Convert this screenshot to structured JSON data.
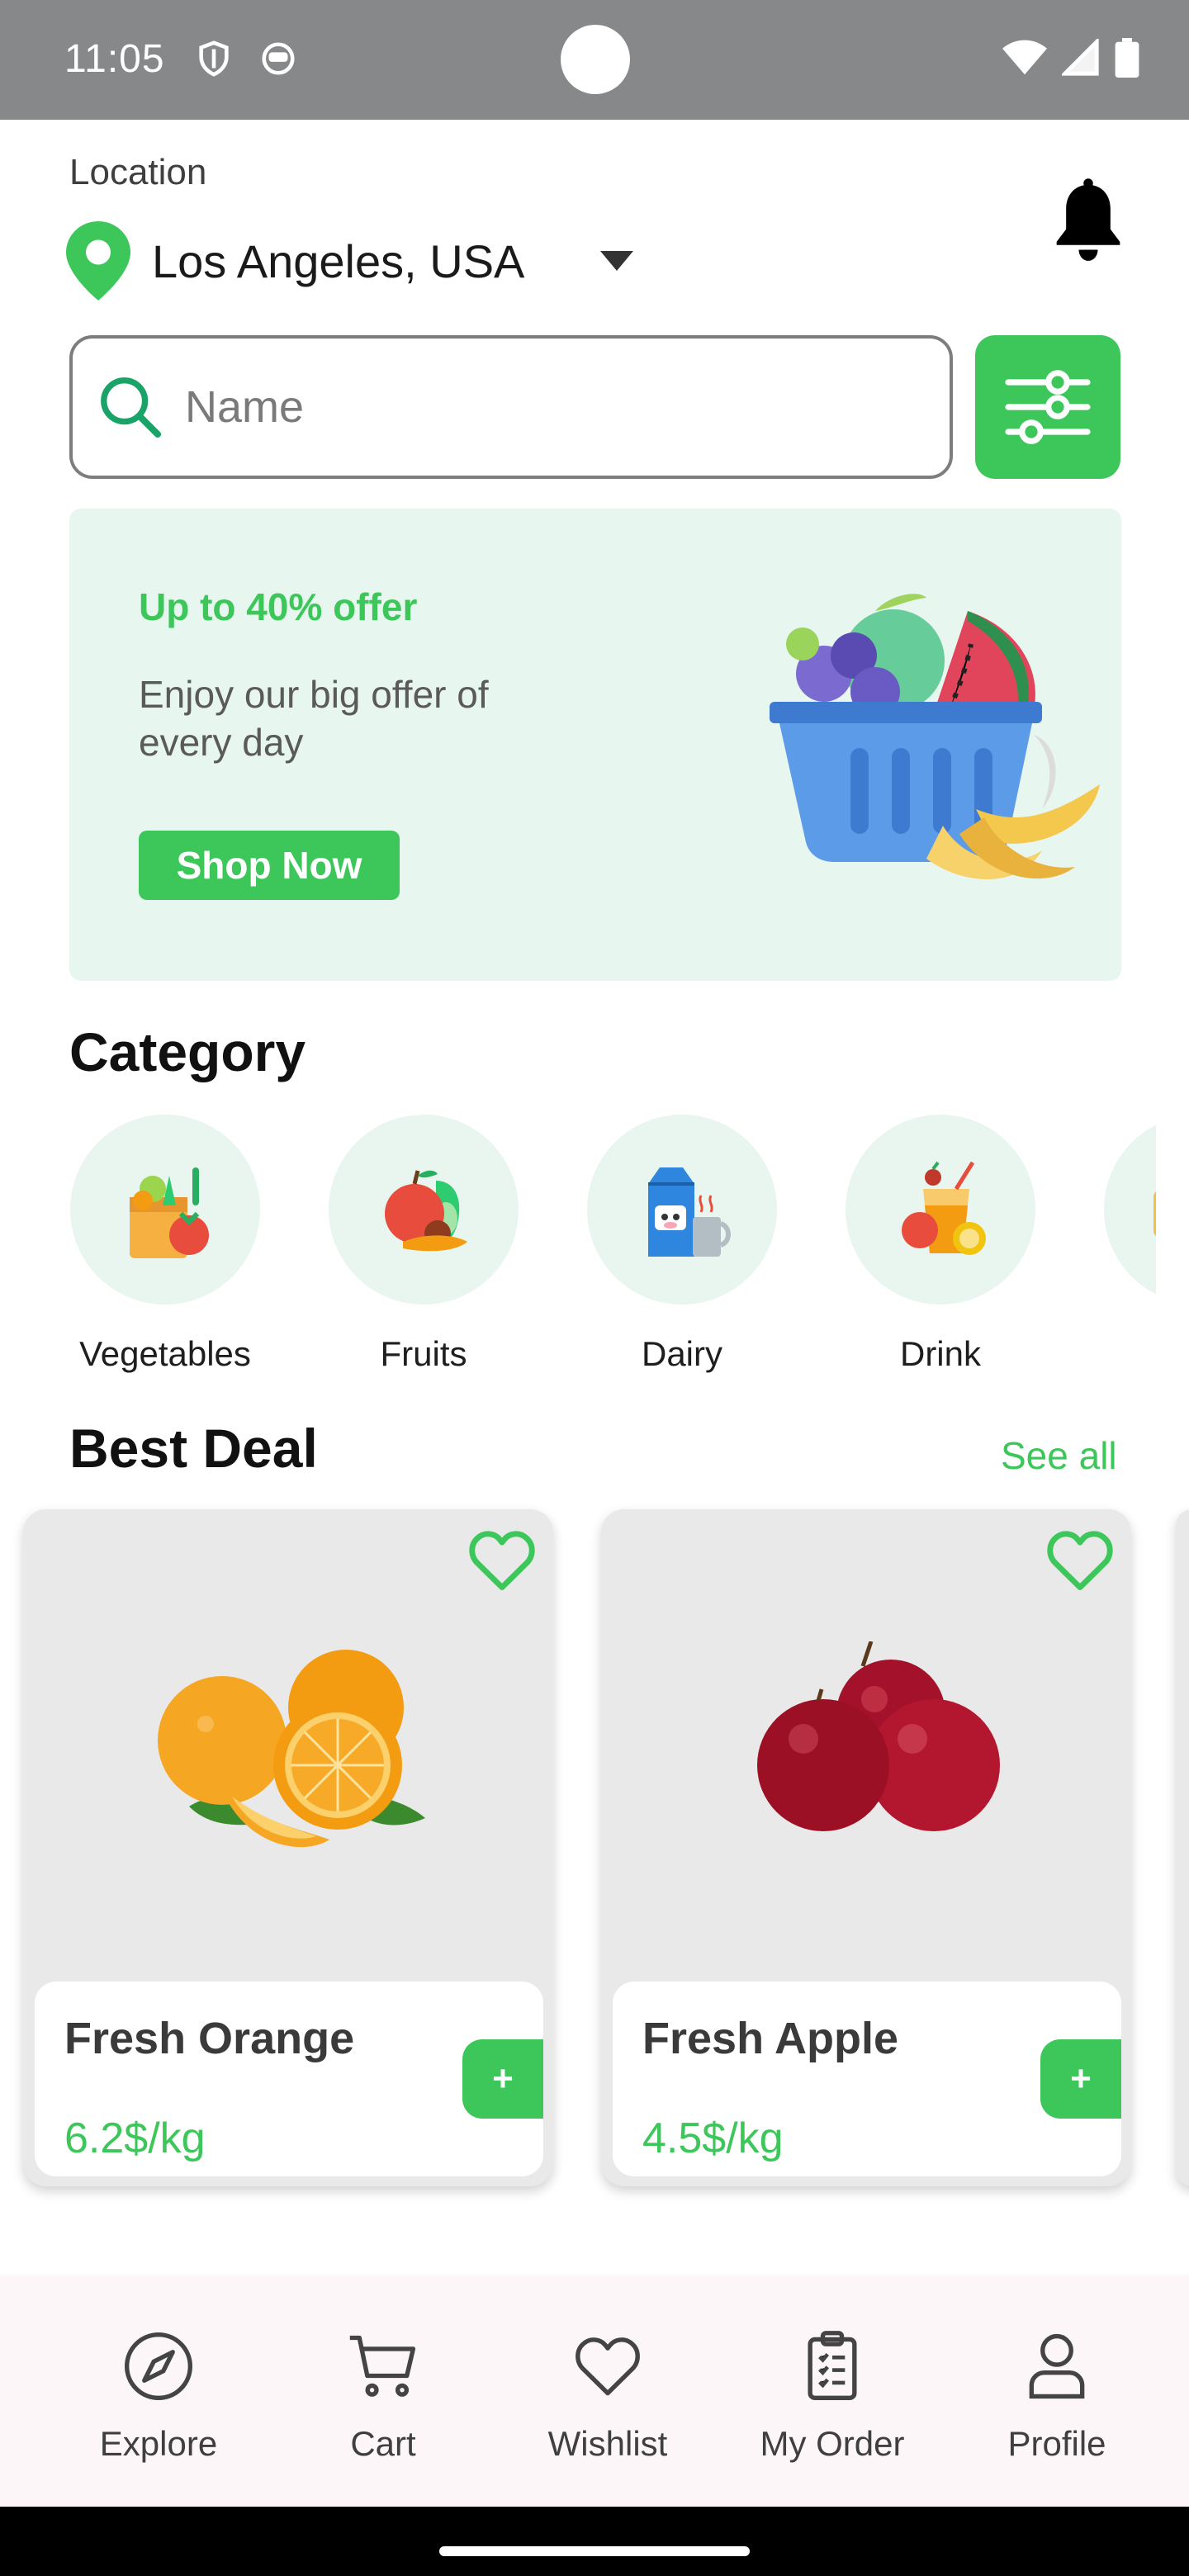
{
  "status_bar": {
    "time": "11:05"
  },
  "location": {
    "label": "Location",
    "city": "Los Angeles, USA"
  },
  "search": {
    "placeholder": "Name"
  },
  "promo": {
    "title": "Up to 40% offer",
    "subtitle": "Enjoy our big offer of every day",
    "button_label": "Shop Now"
  },
  "category": {
    "title": "Category",
    "items": [
      {
        "label": "Vegetables",
        "icon": "vegetables-icon"
      },
      {
        "label": "Fruits",
        "icon": "fruits-icon"
      },
      {
        "label": "Dairy",
        "icon": "dairy-icon"
      },
      {
        "label": "Drink",
        "icon": "drink-icon"
      }
    ]
  },
  "best_deal": {
    "title": "Best Deal",
    "see_all": "See all",
    "products": [
      {
        "name": "Fresh Orange",
        "price": "6.2$/kg",
        "add": "+"
      },
      {
        "name": "Fresh Apple",
        "price": "4.5$/kg",
        "add": "+"
      }
    ]
  },
  "bottom_nav": {
    "items": [
      {
        "label": "Explore",
        "icon": "compass-icon"
      },
      {
        "label": "Cart",
        "icon": "cart-icon"
      },
      {
        "label": "Wishlist",
        "icon": "heart-icon"
      },
      {
        "label": "My Order",
        "icon": "clipboard-icon"
      },
      {
        "label": "Profile",
        "icon": "person-icon"
      }
    ]
  },
  "colors": {
    "accent": "#3dc75a",
    "promo_bg": "#e7f6ef",
    "status_bar": "#868889"
  }
}
